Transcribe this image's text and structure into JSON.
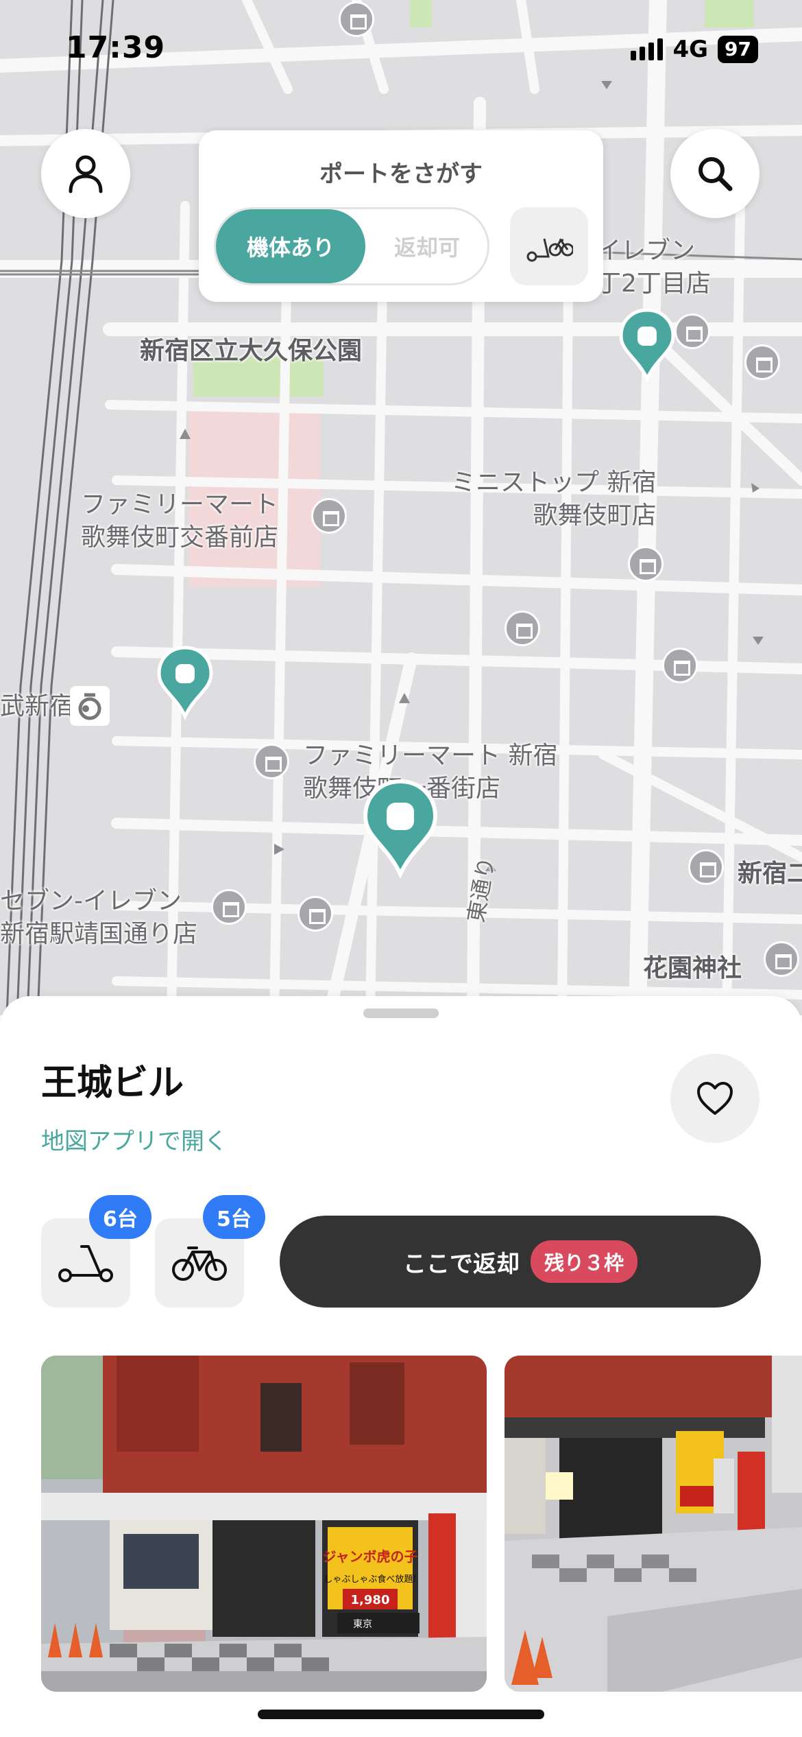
{
  "status_bar": {
    "time": "17:39",
    "network": "4G",
    "battery": "97"
  },
  "finder": {
    "title": "ポートをさがす",
    "segment_active": "機体あり",
    "segment_inactive": "返却可"
  },
  "icons": {
    "profile": "person-icon",
    "search": "search-icon",
    "filter": "scooter-bike-icon",
    "favorite": "heart-icon",
    "scooter": "kick-scooter-icon",
    "bicycle": "bicycle-icon"
  },
  "map": {
    "labels": {
      "okubo_park": "新宿区立大久保公園",
      "seven_top": "イレブン\n丁2丁目店",
      "familymart_koban": "ファミリーマート\n歌舞伎町交番前店",
      "ministop": "ミニストップ 新宿\n歌舞伎町店",
      "station": "武新宿",
      "familymart_ichiban": "ファミリーマート 新宿\n歌舞伎町一番街店",
      "seven_yasukuni": "セブン-イレブン\n新宿駅靖国通り店",
      "higashi_dori": "東通り",
      "shinjuku_right": "新宿二",
      "hanazono": "花園神社"
    },
    "colors": {
      "pin": "#4aa7a0",
      "road": "#f8f8f8",
      "block": "#dcdcde"
    }
  },
  "sheet": {
    "place_name": "王城ビル",
    "open_in_maps": "地図アプリで開く",
    "scooter_count": "6台",
    "bicycle_count": "5台",
    "return_label": "ここで返却",
    "slots_remaining": "残り３枠",
    "photo_signs": {
      "sign_main": "ジャンボ虎の子",
      "sign_sub": "しゃぶしゃぶ食べ放題!",
      "price": "1,980",
      "tokyo": "東京"
    }
  },
  "colors": {
    "accent": "#4aa7a0",
    "badge_blue": "#2f7cf6",
    "badge_red": "#d94a5e",
    "dark_button": "#333333"
  }
}
